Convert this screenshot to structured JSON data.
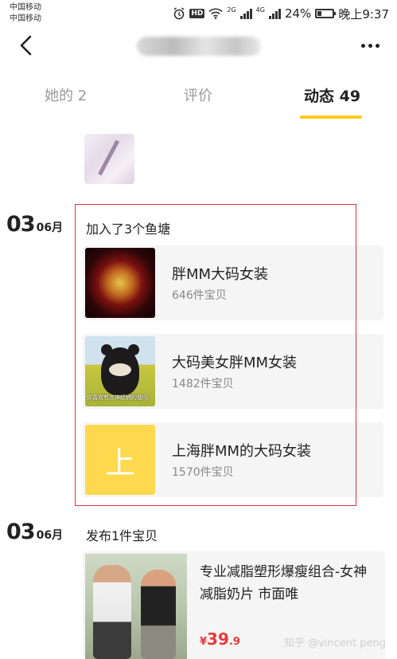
{
  "status_bar": {
    "carrier_1": "中国移动",
    "carrier_2": "中国移动",
    "net_1": "2G",
    "net_2": "4G",
    "battery": "24%",
    "time": "晚上9:37"
  },
  "header": {
    "back_icon": "chevron-left-icon",
    "more_icon": "more-dots-icon"
  },
  "tabs": [
    {
      "label": "她的 2"
    },
    {
      "label": "评价"
    },
    {
      "label": "动态 49",
      "active": true
    }
  ],
  "accent_color": "#ffc91a",
  "highlight_color": "#d9333f",
  "feed": [
    {
      "day": "03",
      "month": "06月",
      "title": "加入了3个鱼塘",
      "items": [
        {
          "name": "胖MM大码女装",
          "count": "646件宝贝"
        },
        {
          "name": "大码美女胖MM女装",
          "count": "1482件宝贝",
          "thumb_caption": "你喜欢有点神经病的我吗"
        },
        {
          "name": "上海胖MM的大码女装",
          "count": "1570件宝贝",
          "thumb_char": "上"
        }
      ]
    },
    {
      "day": "03",
      "month": "06月",
      "title": "发布1件宝贝",
      "product": {
        "title": "专业减脂塑形爆瘦组合-女神减脂奶片 市面唯",
        "price_currency": "¥",
        "price_int": "39",
        "price_dec": ".9"
      }
    }
  ],
  "watermark": "知乎 @vincent peng"
}
